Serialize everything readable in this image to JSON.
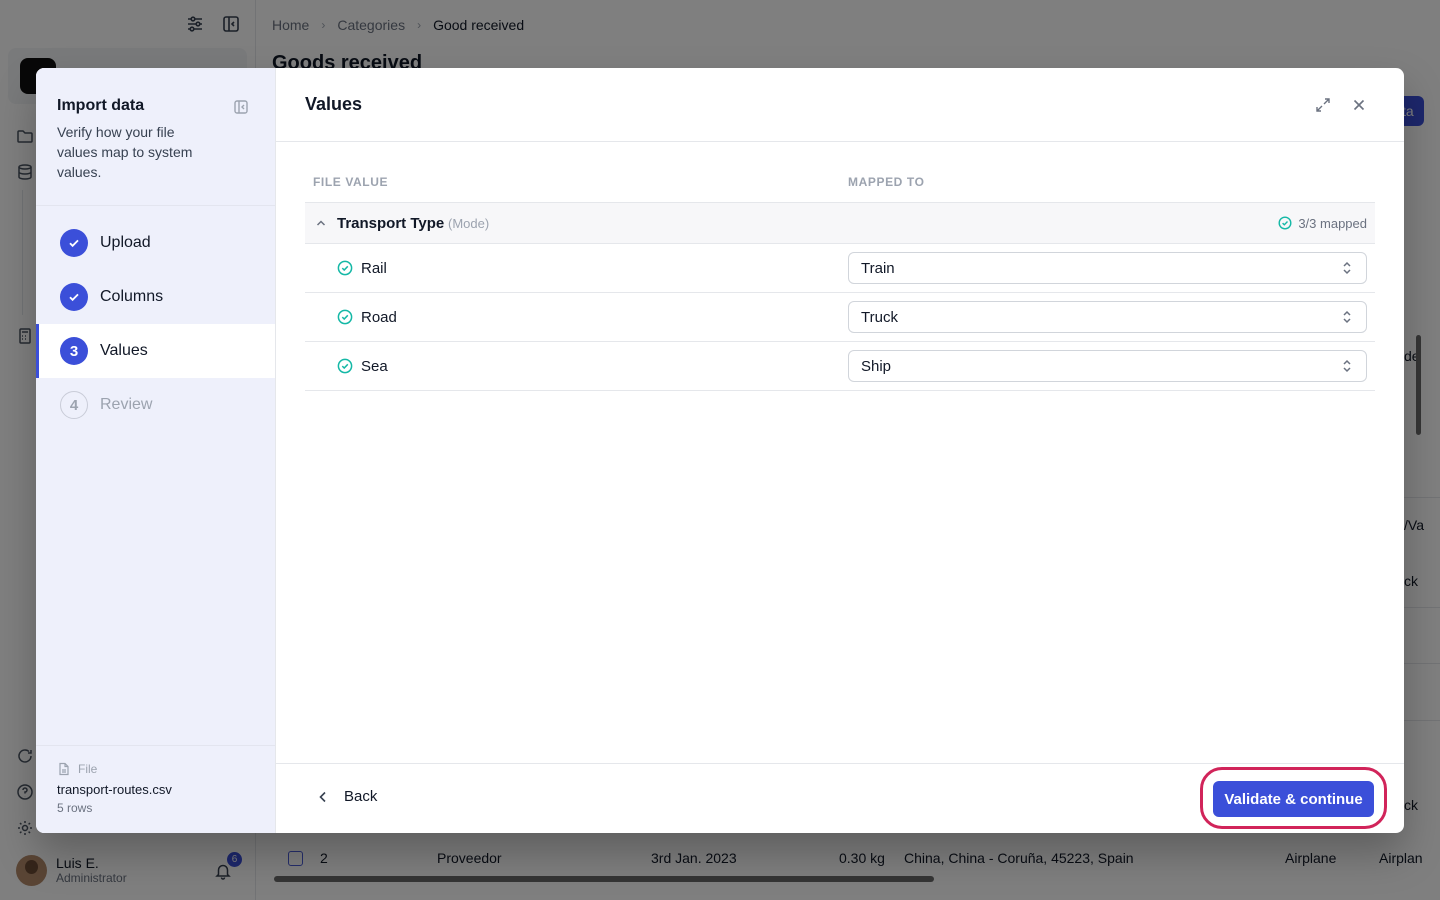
{
  "background": {
    "breadcrumb": [
      "Home",
      "Categories",
      "Good received"
    ],
    "page_title": "Goods received",
    "primary_button_fragment": "ta",
    "row": {
      "index": "2",
      "supplier": "Proveedor",
      "date": "3rd Jan. 2023",
      "weight": "0.30 kg",
      "route": "China, China - Coruña, 45223, Spain",
      "mode": "Airplane",
      "mode_fragment": "Airplan"
    },
    "right_fragments": [
      "de",
      "/Va",
      "ck",
      "ck"
    ],
    "user": {
      "name": "Luis E.",
      "role": "Administrator",
      "notifications": "6"
    }
  },
  "modal": {
    "sidebar": {
      "title": "Import data",
      "description": "Verify how your file values map to system values.",
      "steps": [
        {
          "number": "1",
          "label": "Upload",
          "state": "done"
        },
        {
          "number": "2",
          "label": "Columns",
          "state": "done"
        },
        {
          "number": "3",
          "label": "Values",
          "state": "current"
        },
        {
          "number": "4",
          "label": "Review",
          "state": "todo"
        }
      ],
      "file": {
        "caption": "File",
        "name": "transport-routes.csv",
        "rows": "5 rows"
      }
    },
    "title": "Values",
    "table": {
      "col_file_value": "FILE VALUE",
      "col_mapped_to": "MAPPED TO",
      "group": {
        "name": "Transport Type",
        "sub": "(Mode)",
        "status": "3/3 mapped"
      },
      "rows": [
        {
          "file_value": "Rail",
          "mapped_to": "Train"
        },
        {
          "file_value": "Road",
          "mapped_to": "Truck"
        },
        {
          "file_value": "Sea",
          "mapped_to": "Ship"
        }
      ]
    },
    "footer": {
      "back_label": "Back",
      "primary_label": "Validate & continue"
    }
  },
  "colors": {
    "accent": "#3b4fd9",
    "success": "#14b8a6",
    "highlight": "#d1245a"
  }
}
